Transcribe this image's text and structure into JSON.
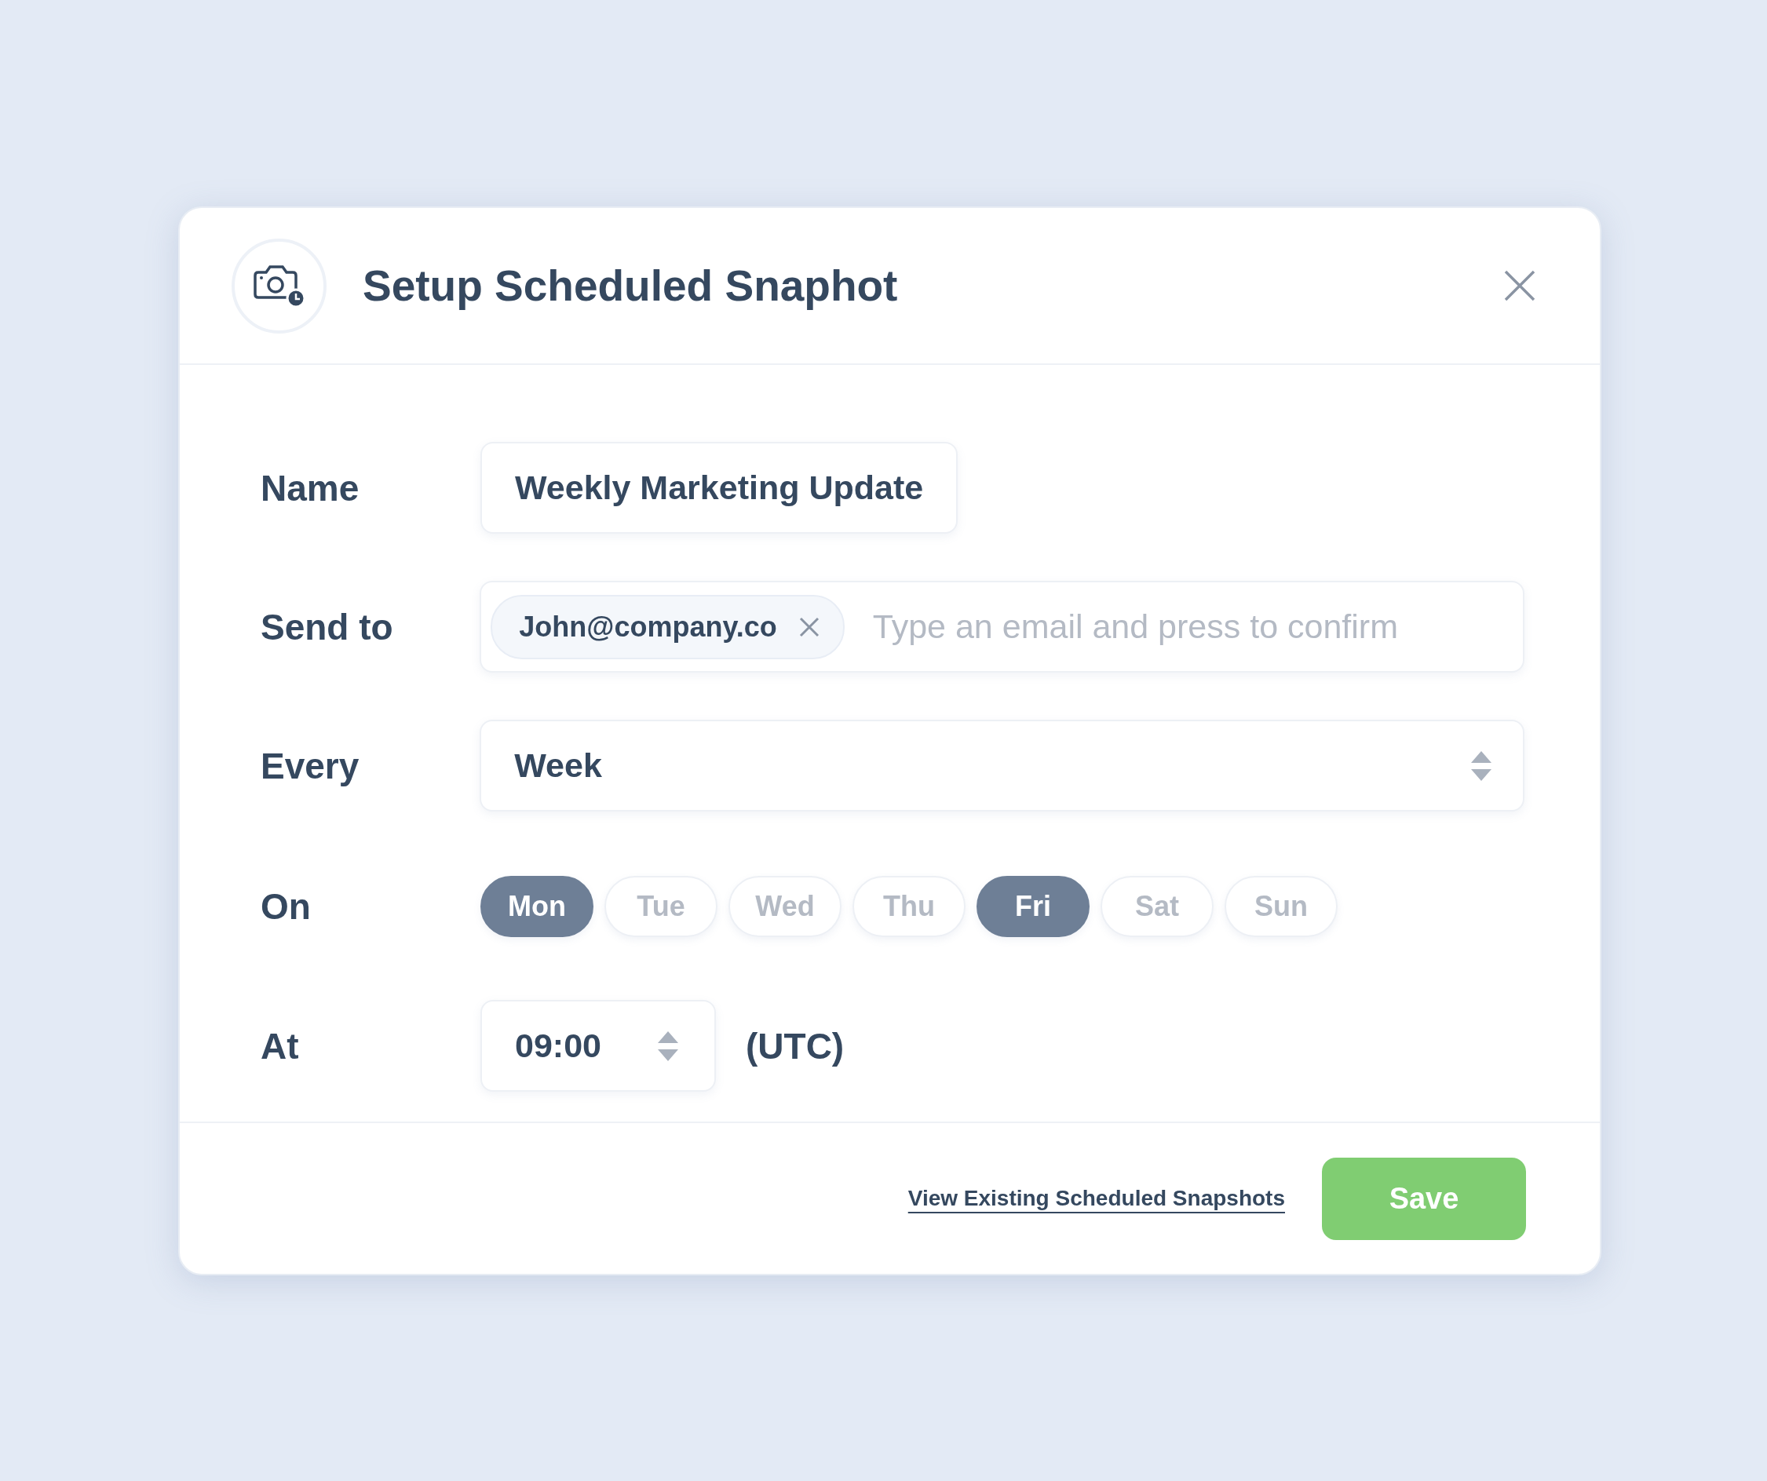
{
  "dialog": {
    "title": "Setup Scheduled Snaphot"
  },
  "fields": [
    {
      "kind": "text",
      "label": "Name",
      "value": "Weekly Marketing Update"
    },
    {
      "kind": "tags",
      "label": "Send to",
      "tags": [
        "John@company.co"
      ],
      "placeholder": "Type an email and press to confirm"
    },
    {
      "kind": "select",
      "label": "Every",
      "value": "Week"
    },
    {
      "kind": "days",
      "label": "On",
      "days": [
        {
          "label": "Mon",
          "selected": true
        },
        {
          "label": "Tue",
          "selected": false
        },
        {
          "label": "Wed",
          "selected": false
        },
        {
          "label": "Thu",
          "selected": false
        },
        {
          "label": "Fri",
          "selected": true
        },
        {
          "label": "Sat",
          "selected": false
        },
        {
          "label": "Sun",
          "selected": false
        }
      ]
    },
    {
      "kind": "time",
      "label": "At",
      "value": "09:00",
      "suffix": "(UTC)"
    }
  ],
  "footer": {
    "link": "View Existing Scheduled Snapshots",
    "button": "Save"
  }
}
